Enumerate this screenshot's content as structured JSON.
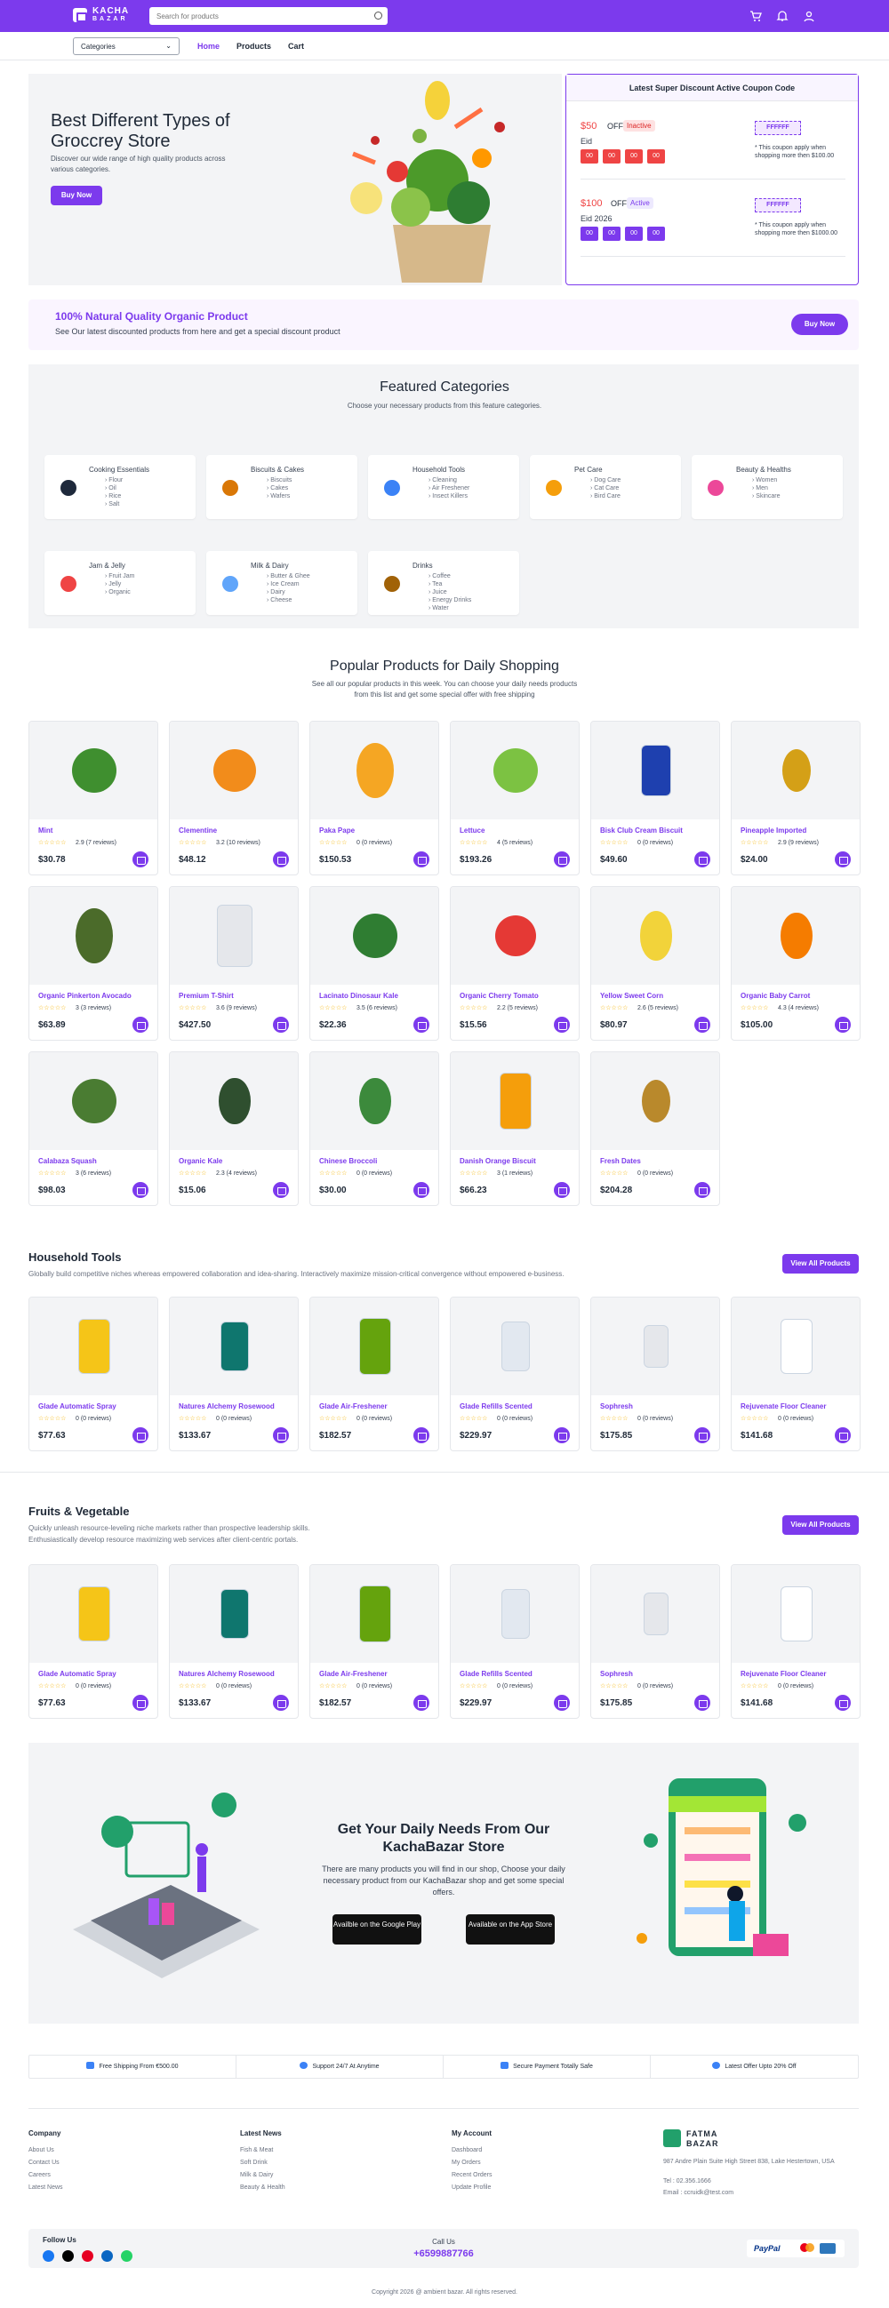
{
  "header": {
    "logo_line1": "KACHA",
    "logo_line2": "BAZAR",
    "search_placeholder": "Search for products",
    "icons": [
      "cart-icon",
      "bell-icon",
      "user-icon"
    ]
  },
  "nav": {
    "categories_label": "Categories",
    "links": [
      "Home",
      "Products",
      "Cart"
    ]
  },
  "hero": {
    "title": "Best Different Types of Groccrey Store",
    "desc": "Discover our wide range of high quality products across various categories.",
    "button": "Buy Now"
  },
  "coupons": {
    "heading": "Latest Super Discount Active Coupon Code",
    "items": [
      {
        "amount": "$50",
        "off": "OFF",
        "status": "Inactive",
        "title": "Eid",
        "timer": [
          "00",
          "00",
          "00",
          "00"
        ],
        "code": "FFFFFF",
        "note": "* This coupon apply when shopping more then $100.00"
      },
      {
        "amount": "$100",
        "off": "OFF",
        "status": "Active",
        "title": "Eid 2026",
        "timer": [
          "00",
          "00",
          "00",
          "00"
        ],
        "code": "FFFFFF",
        "note": "* This coupon apply when shopping more then $1000.00"
      }
    ]
  },
  "promo": {
    "title": "100% Natural Quality Organic Product",
    "desc": "See Our latest discounted products from here and get a special discount product",
    "button": "Buy Now"
  },
  "featured": {
    "title": "Featured Categories",
    "subtitle": "Choose your necessary products from this feature categories.",
    "categories": [
      {
        "name": "Cooking Essentials",
        "items": [
          "Flour",
          "Oil",
          "Rice",
          "Salt"
        ]
      },
      {
        "name": "Biscuits & Cakes",
        "items": [
          "Biscuits",
          "Cakes",
          "Wafers"
        ]
      },
      {
        "name": "Household Tools",
        "items": [
          "Cleaning",
          "Air Freshener",
          "Insect Killers"
        ]
      },
      {
        "name": "Pet Care",
        "items": [
          "Dog Care",
          "Cat Care",
          "Bird Care"
        ]
      },
      {
        "name": "Beauty & Healths",
        "items": [
          "Women",
          "Men",
          "Skincare"
        ]
      },
      {
        "name": "Jam & Jelly",
        "items": [
          "Fruit Jam",
          "Jelly",
          "Organic"
        ]
      },
      {
        "name": "Milk & Dairy",
        "items": [
          "Butter & Ghee",
          "Ice Cream",
          "Dairy",
          "Cheese"
        ]
      },
      {
        "name": "Drinks",
        "items": [
          "Coffee",
          "Tea",
          "Juice",
          "Energy Drinks",
          "Water"
        ]
      }
    ]
  },
  "popular": {
    "title": "Popular Products for Daily Shopping",
    "subtitle": "See all our popular products in this week. You can choose your daily needs products from this list and get some special offer with free shipping",
    "products": [
      {
        "name": "Mint",
        "rating": "2.9 (7 reviews)",
        "price": "$30.78"
      },
      {
        "name": "Clementine",
        "rating": "3.2 (10 reviews)",
        "price": "$48.12"
      },
      {
        "name": "Paka Pape",
        "rating": "0 (0 reviews)",
        "price": "$150.53"
      },
      {
        "name": "Lettuce",
        "rating": "4 (5 reviews)",
        "price": "$193.26"
      },
      {
        "name": "Bisk Club Cream Biscuit",
        "rating": "0 (0 reviews)",
        "price": "$49.60"
      },
      {
        "name": "Pineapple Imported",
        "rating": "2.9 (9 reviews)",
        "price": "$24.00"
      },
      {
        "name": "Organic Pinkerton Avocado",
        "rating": "3 (3 reviews)",
        "price": "$63.89"
      },
      {
        "name": "Premium T-Shirt",
        "rating": "3.6 (9 reviews)",
        "price": "$427.50"
      },
      {
        "name": "Lacinato Dinosaur Kale",
        "rating": "3.5 (6 reviews)",
        "price": "$22.36"
      },
      {
        "name": "Organic Cherry Tomato",
        "rating": "2.2 (5 reviews)",
        "price": "$15.56"
      },
      {
        "name": "Yellow Sweet Corn",
        "rating": "2.6 (5 reviews)",
        "price": "$80.97"
      },
      {
        "name": "Organic Baby Carrot",
        "rating": "4.3 (4 reviews)",
        "price": "$105.00"
      },
      {
        "name": "Calabaza Squash",
        "rating": "3 (6 reviews)",
        "price": "$98.03"
      },
      {
        "name": "Organic Kale",
        "rating": "2.3 (4 reviews)",
        "price": "$15.06"
      },
      {
        "name": "Chinese Broccoli",
        "rating": "0 (0 reviews)",
        "price": "$30.00"
      },
      {
        "name": "Danish Orange Biscuit",
        "rating": "3 (1 reviews)",
        "price": "$66.23"
      },
      {
        "name": "Fresh Dates",
        "rating": "0 (0 reviews)",
        "price": "$204.28"
      }
    ]
  },
  "household": {
    "title": "Household Tools",
    "desc": "Globally build competitive niches whereas empowered collaboration and idea-sharing. Interactively maximize mission-critical convergence without empowered e-business.",
    "button": "View All Products",
    "products": [
      {
        "name": "Glade Automatic Spray",
        "rating": "0 (0 reviews)",
        "price": "$77.63"
      },
      {
        "name": "Natures Alchemy Rosewood",
        "rating": "0 (0 reviews)",
        "price": "$133.67"
      },
      {
        "name": "Glade Air-Freshener",
        "rating": "0 (0 reviews)",
        "price": "$182.57"
      },
      {
        "name": "Glade Refills Scented",
        "rating": "0 (0 reviews)",
        "price": "$229.97"
      },
      {
        "name": "Sophresh",
        "rating": "0 (0 reviews)",
        "price": "$175.85"
      },
      {
        "name": "Rejuvenate Floor Cleaner",
        "rating": "0 (0 reviews)",
        "price": "$141.68"
      }
    ]
  },
  "fruits": {
    "title": "Fruits & Vegetable",
    "desc1": "Quickly unleash resource-leveling niche markets rather than prospective leadership skills.",
    "desc2": "Enthusiastically develop resource maximizing web services after client-centric portals.",
    "button": "View All Products",
    "products": [
      {
        "name": "Glade Automatic Spray",
        "rating": "0 (0 reviews)",
        "price": "$77.63"
      },
      {
        "name": "Natures Alchemy Rosewood",
        "rating": "0 (0 reviews)",
        "price": "$133.67"
      },
      {
        "name": "Glade Air-Freshener",
        "rating": "0 (0 reviews)",
        "price": "$182.57"
      },
      {
        "name": "Glade Refills Scented",
        "rating": "0 (0 reviews)",
        "price": "$229.97"
      },
      {
        "name": "Sophresh",
        "rating": "0 (0 reviews)",
        "price": "$175.85"
      },
      {
        "name": "Rejuvenate Floor Cleaner",
        "rating": "0 (0 reviews)",
        "price": "$141.68"
      }
    ]
  },
  "app": {
    "title": "Get Your Daily Needs From Our KachaBazar Store",
    "desc": "There are many products you will find in our shop, Choose your daily necessary product from our KachaBazar shop and get some special offers.",
    "google": "Availble on the Google Play",
    "apple": "Available on the App Store"
  },
  "features": [
    "Free Shipping From €500.00",
    "Support 24/7 At Anytime",
    "Secure Payment Totally Safe",
    "Latest Offer Upto 20% Off"
  ],
  "footer": {
    "company": {
      "title": "Company",
      "links": [
        "About Us",
        "Contact Us",
        "Careers",
        "Latest News"
      ]
    },
    "news": {
      "title": "Latest News",
      "links": [
        "Fish & Meat",
        "Soft Drink",
        "Milk & Dairy",
        "Beauty & Health"
      ]
    },
    "account": {
      "title": "My Account",
      "links": [
        "Dashboard",
        "My Orders",
        "Recent Orders",
        "Update Profile"
      ]
    },
    "brand_line1": "FATMA",
    "brand_line2": "BAZAR",
    "address": "987 Andre Plain Suite High Street 838, Lake Hestertown, USA",
    "tel": "Tel : 02.356.1666",
    "email": "Email : ccruidk@test.com",
    "follow": "Follow Us",
    "call": "Call Us",
    "phone": "+6599887766",
    "copyright": "Copyright 2026 @ ambient bazar. All rights reserved."
  }
}
